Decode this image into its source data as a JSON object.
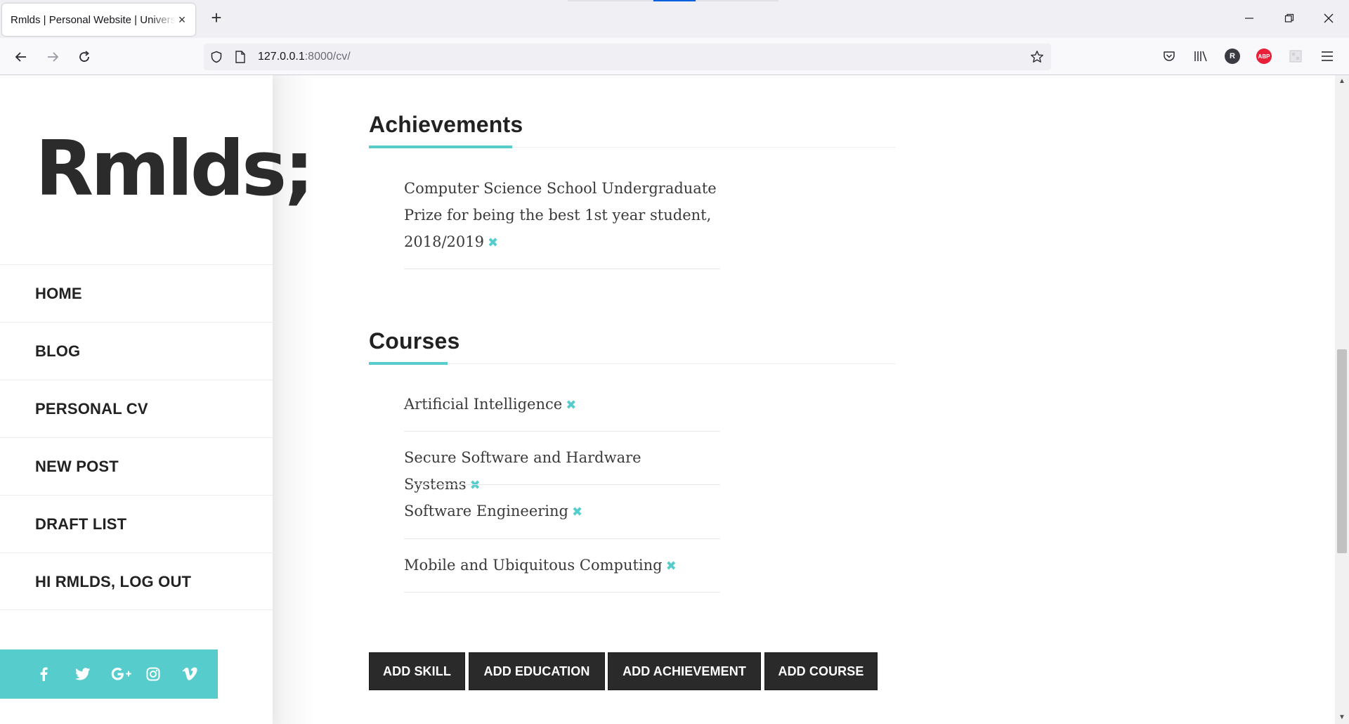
{
  "browser": {
    "tab_title": "Rmlds | Personal Website | University of Birmingham",
    "url_host": "127.0.0.1",
    "url_rest": ":8000/cv/",
    "new_tab_glyph": "+",
    "close_glyph": "×",
    "icons": [
      "back-icon",
      "forward-icon",
      "reload-icon",
      "shield-icon",
      "page-icon",
      "star-icon",
      "pocket-icon",
      "library-icon",
      "profile-icon",
      "adblock-icon",
      "extension-icon",
      "menu-icon"
    ],
    "profile_badge": "R",
    "abp_badge": "ABP"
  },
  "site": {
    "logo": "Rmlds;",
    "accent_color": "#56cccc",
    "menu": [
      {
        "label": "HOME"
      },
      {
        "label": "BLOG"
      },
      {
        "label": "PERSONAL CV"
      },
      {
        "label": "NEW POST"
      },
      {
        "label": "DRAFT LIST"
      },
      {
        "label": "HI RMLDS, LOG OUT"
      }
    ],
    "social": [
      "facebook-icon",
      "twitter-icon",
      "google-plus-icon",
      "instagram-icon",
      "vimeo-icon"
    ]
  },
  "cv": {
    "achievements": {
      "title": "Achievements",
      "items": [
        "Computer Science School Undergraduate Prize for being the best 1st year student, 2018/2019"
      ]
    },
    "courses": {
      "title": "Courses",
      "items": [
        "Artificial Intelligence",
        "Secure Software and Hardware Systems",
        "Software Engineering",
        "Mobile and Ubiquitous Computing"
      ]
    },
    "delete_glyph": "✖",
    "buttons": {
      "add_skill": "ADD SKILL",
      "add_education": "ADD EDUCATION",
      "add_achievement": "ADD ACHIEVEMENT",
      "add_course": "ADD COURSE"
    }
  }
}
